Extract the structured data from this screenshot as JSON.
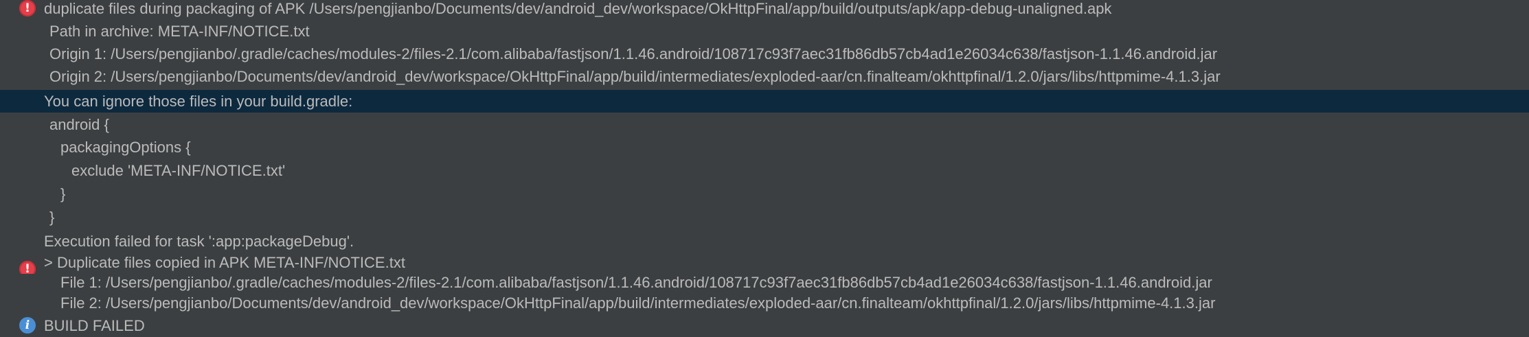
{
  "console": {
    "lines": [
      "duplicate files during packaging of APK /Users/pengjianbo/Documents/dev/android_dev/workspace/OkHttpFinal/app/build/outputs/apk/app-debug-unaligned.apk",
      "Path in archive: META-INF/NOTICE.txt",
      "Origin 1: /Users/pengjianbo/.gradle/caches/modules-2/files-2.1/com.alibaba/fastjson/1.1.46.android/108717c93f7aec31fb86db57cb4ad1e26034c638/fastjson-1.1.46.android.jar",
      "Origin 2: /Users/pengjianbo/Documents/dev/android_dev/workspace/OkHttpFinal/app/build/intermediates/exploded-aar/cn.finalteam/okhttpfinal/1.2.0/jars/libs/httpmime-4.1.3.jar",
      "You can ignore those files in your build.gradle:",
      "android {",
      "packagingOptions {",
      "exclude 'META-INF/NOTICE.txt'",
      "}",
      "}",
      "Execution failed for task ':app:packageDebug'.",
      "> Duplicate files copied in APK META-INF/NOTICE.txt",
      "File 1: /Users/pengjianbo/.gradle/caches/modules-2/files-2.1/com.alibaba/fastjson/1.1.46.android/108717c93f7aec31fb86db57cb4ad1e26034c638/fastjson-1.1.46.android.jar",
      "File 2: /Users/pengjianbo/Documents/dev/android_dev/workspace/OkHttpFinal/app/build/intermediates/exploded-aar/cn.finalteam/okhttpfinal/1.2.0/jars/libs/httpmime-4.1.3.jar",
      "BUILD FAILED"
    ],
    "icons": [
      "error-icon",
      "error-icon",
      "info-icon"
    ],
    "colors": {
      "background": "#3c3f41",
      "selected_background": "#0d293e",
      "text": "#bbbbbb",
      "error": "#e3404b",
      "info": "#4a8fd6"
    }
  }
}
